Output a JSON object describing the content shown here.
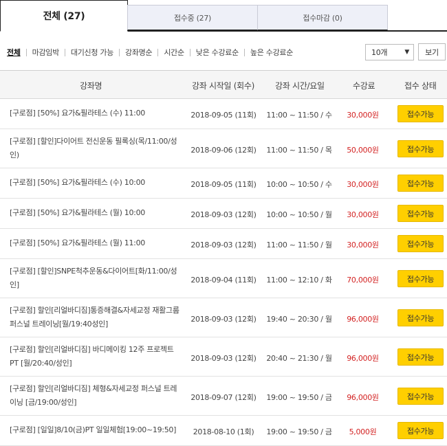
{
  "tabs": [
    {
      "label": "전체 (27)"
    },
    {
      "label": "접수중 (27)"
    },
    {
      "label": "접수마감 (0)"
    }
  ],
  "filters": [
    "전체",
    "마감임박",
    "대기신청 가능",
    "강좌명순",
    "시간순",
    "낮은 수강료순",
    "높은 수강료순"
  ],
  "page_size": {
    "value": "10개"
  },
  "view_button": "보기",
  "headers": {
    "name": "강좌명",
    "start": "강좌 시작일 (회수)",
    "time": "강좌 시간/요일",
    "price": "수강료",
    "status": "접수 상태"
  },
  "rows": [
    {
      "name": "[구로점] [50%] 요가&필라테스 (수) 11:00",
      "start": "2018-09-05 (11회)",
      "time": "11:00 ~ 11:50 / 수",
      "price": "30,000원",
      "status": "접수가능"
    },
    {
      "name": "[구로점] [할인]다이어트 전신운동 필록싱(목/11:00/성인)",
      "start": "2018-09-06 (12회)",
      "time": "11:00 ~ 11:50 / 목",
      "price": "50,000원",
      "status": "접수가능"
    },
    {
      "name": "[구로점] [50%] 요가&필라테스 (수) 10:00",
      "start": "2018-09-05 (11회)",
      "time": "10:00 ~ 10:50 / 수",
      "price": "30,000원",
      "status": "접수가능"
    },
    {
      "name": "[구로점] [50%] 요가&필라테스 (월) 10:00",
      "start": "2018-09-03 (12회)",
      "time": "10:00 ~ 10:50 / 월",
      "price": "30,000원",
      "status": "접수가능"
    },
    {
      "name": "[구로점] [50%] 요가&필라테스 (월) 11:00",
      "start": "2018-09-03 (12회)",
      "time": "11:00 ~ 11:50 / 월",
      "price": "30,000원",
      "status": "접수가능"
    },
    {
      "name": "[구로점] [할인]SNPE척추운동&다이어트[화/11:00/성인]",
      "start": "2018-09-04 (11회)",
      "time": "11:00 ~ 12:10 / 화",
      "price": "70,000원",
      "status": "접수가능"
    },
    {
      "name": "[구로점] 할인[리얼바디짐]통증해결&자세교정 재활그룹 퍼스널 트레이닝[월/19:40성인]",
      "start": "2018-09-03 (12회)",
      "time": "19:40 ~ 20:30 / 월",
      "price": "96,000원",
      "status": "접수가능"
    },
    {
      "name": "[구로점] 할인[리얼바디짐] 바디메이킹 12주 프로젝트 PT [월/20:40/성인]",
      "start": "2018-09-03 (12회)",
      "time": "20:40 ~ 21:30 / 월",
      "price": "96,000원",
      "status": "접수가능"
    },
    {
      "name": "[구로점] 할인[리얼바디짐] 체형&자세교정 퍼스널 트레이닝 [금/19:00/성인]",
      "start": "2018-09-07 (12회)",
      "time": "19:00 ~ 19:50 / 금",
      "price": "96,000원",
      "status": "접수가능"
    },
    {
      "name": "[구로점] [일일]8/10(금)PT 일일체험[19:00~19:50]",
      "start": "2018-08-10 (1회)",
      "time": "19:00 ~ 19:50 / 금",
      "price": "5,000원",
      "status": "접수가능"
    }
  ],
  "colors": {
    "accent": "#ffcf00",
    "price": "#d32222"
  }
}
